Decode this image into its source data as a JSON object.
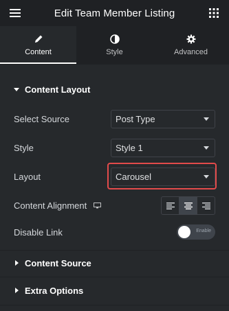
{
  "header": {
    "title": "Edit Team Member Listing",
    "menu_icon": "hamburger-icon",
    "grid_icon": "grid-icon"
  },
  "tabs": [
    {
      "label": "Content",
      "icon": "pencil-icon",
      "active": true
    },
    {
      "label": "Style",
      "icon": "half-circle-icon",
      "active": false
    },
    {
      "label": "Advanced",
      "icon": "gear-icon",
      "active": false
    }
  ],
  "content_layout": {
    "title": "Content Layout",
    "expanded": true,
    "fields": {
      "select_source": {
        "label": "Select Source",
        "value": "Post Type"
      },
      "style": {
        "label": "Style",
        "value": "Style 1"
      },
      "layout": {
        "label": "Layout",
        "value": "Carousel",
        "highlighted": true,
        "highlight_color": "#e34b4b"
      },
      "content_alignment": {
        "label": "Content Alignment",
        "device_icon": "monitor-icon",
        "options": [
          "left",
          "center",
          "right"
        ],
        "selected": "center"
      },
      "disable_link": {
        "label": "Disable Link",
        "toggle_text": "Enable",
        "on": false
      }
    }
  },
  "content_source": {
    "title": "Content Source",
    "expanded": false
  },
  "extra_options": {
    "title": "Extra Options",
    "expanded": false
  },
  "colors": {
    "panel_bg": "#26292c",
    "header_bg": "#1f2124",
    "accent": "#e34b4b"
  }
}
